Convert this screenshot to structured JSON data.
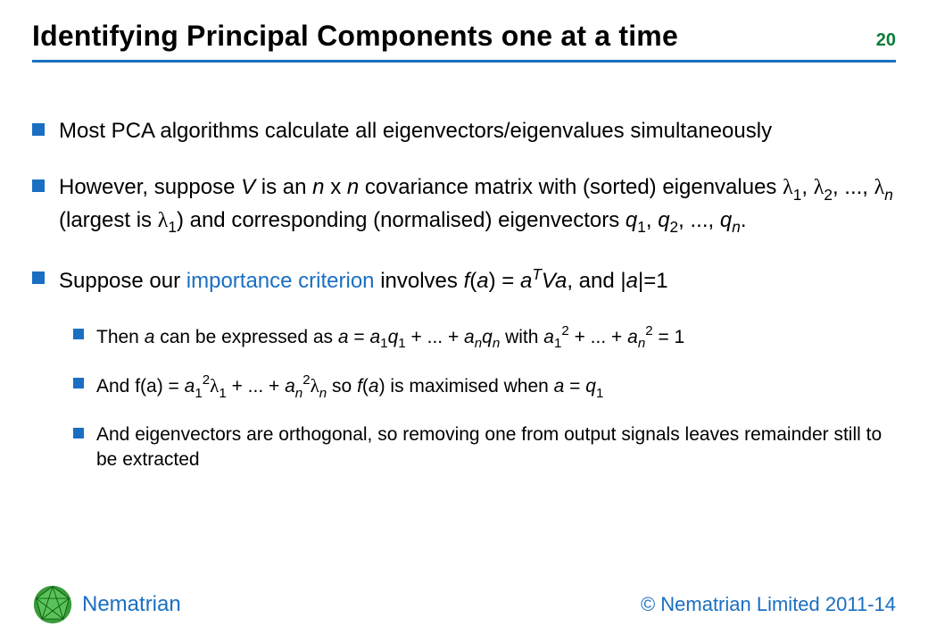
{
  "page_number": "20",
  "title": "Identifying Principal Components one at a time",
  "bullets": {
    "b1": {
      "text": "Most PCA algorithms calculate all eigenvectors/eigenvalues simultaneously"
    },
    "b2": {
      "pre": "However, suppose ",
      "V": "V",
      "mid1": " is an ",
      "n1": "n",
      "times": " x ",
      "n2": "n",
      "mid2": " covariance matrix with (sorted) eigenvalues ",
      "lam": "λ",
      "s1": "1",
      "c1": ", ",
      "s2": "2",
      "c2": ", ..., ",
      "sn": "n",
      "mid3": " (largest is ",
      "s1b": "1",
      "mid4": ") and corresponding (normalised) eigenvectors ",
      "q": "q",
      "qs1": "1",
      "qc1": ", ",
      "qs2": "2",
      "qc2": ", ..., ",
      "qsn": "n",
      "dot": "."
    },
    "b3": {
      "pre": "Suppose our ",
      "link": "importance criterion",
      "mid1": " involves ",
      "f": "f",
      "lp": "(",
      "a": "a",
      "rp_eq": ") = ",
      "aT_a": "a",
      "T": "T",
      "Va": "Va",
      "mid2": ", and |",
      "a2": "a",
      "eq1": "|=1"
    },
    "b3a": {
      "pre": "Then ",
      "a": "a",
      "mid1": " can be expressed as ",
      "a2": "a",
      "eq": " = ",
      "a3": "a",
      "s1": "1",
      "q": "q",
      "qs1": "1",
      "plus_dots": " + ... + ",
      "a4": "a",
      "sn": "n",
      "q2": "q",
      "qsn": "n",
      "with": " with ",
      "a5": "a",
      "s1b": "1",
      "sq2": "2",
      "plus_dots2": " + ... + ",
      "a6": "a",
      "snb": "n",
      "sq2b": "2",
      "eq1": " = 1"
    },
    "b3b": {
      "pre": "And f(a) = ",
      "a1": "a",
      "s1": "1",
      "p2": "2",
      "lam": "λ",
      "ls1": "1",
      "plus_dots": " + ... + ",
      "a2": "a",
      "sn": "n",
      "p2b": "2",
      "lsn": "n",
      "so": " so ",
      "f": "f",
      "lp": "(",
      "a3": "a",
      "rp": ")",
      "mid": " is maximised when ",
      "a4": "a",
      "eq": " = ",
      "q": "q",
      "qs1": "1"
    },
    "b3c": {
      "text": "And eigenvectors are orthogonal, so removing one from output signals leaves remainder still to be extracted"
    }
  },
  "footer": {
    "brand": "Nematrian",
    "copyright": "© Nematrian Limited 2011-14"
  },
  "colors": {
    "accent": "#1a6fc2",
    "page_number": "#0a7d3a"
  }
}
